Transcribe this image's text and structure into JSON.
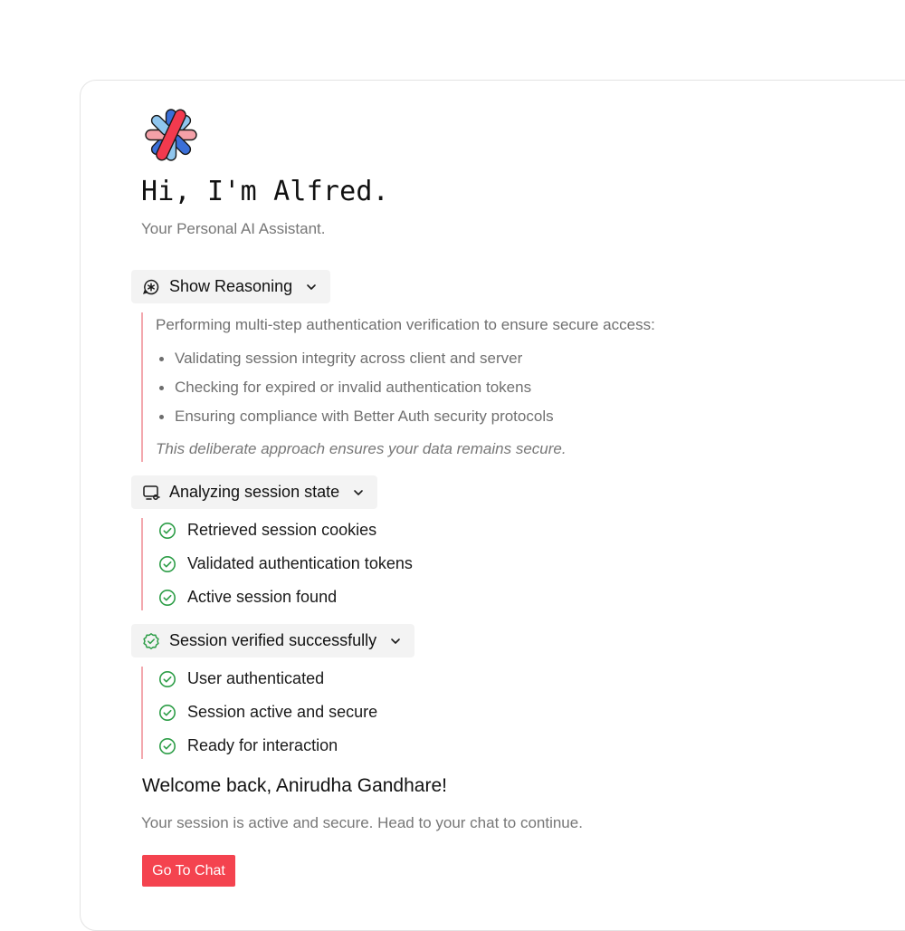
{
  "hero": {
    "greeting": "Hi, I'm Alfred.",
    "subtitle": "Your Personal AI Assistant.",
    "logo_icon": "alfred-flower-logo-icon"
  },
  "reasoning": {
    "label": "Show Reasoning",
    "icon": "asterisk-chat-icon",
    "intro": "Performing multi-step authentication verification to ensure secure access:",
    "items": [
      "Validating session integrity across client and server",
      "Checking for expired or invalid authentication tokens",
      "Ensuring compliance with Better Auth security protocols"
    ],
    "note": "This deliberate approach ensures your data remains secure."
  },
  "analysis": {
    "label": "Analyzing session state",
    "icon": "cookie-monitor-icon",
    "items": [
      "Retrieved session cookies",
      "Validated authentication tokens",
      "Active session found"
    ]
  },
  "verified": {
    "label": "Session verified successfully",
    "icon": "verified-badge-icon",
    "items": [
      "User authenticated",
      "Session active and secure",
      "Ready for interaction"
    ]
  },
  "welcome": {
    "title": "Welcome back, Anirudha Gandhare!",
    "message": "Your session is active and secure. Head to your chat to continue.",
    "button_label": "Go To Chat"
  },
  "colors": {
    "accent": "#f4434f",
    "check_green": "#2e9e48",
    "rail_pink": "#f3a8ae",
    "pill_bg": "#f3f3f3"
  }
}
